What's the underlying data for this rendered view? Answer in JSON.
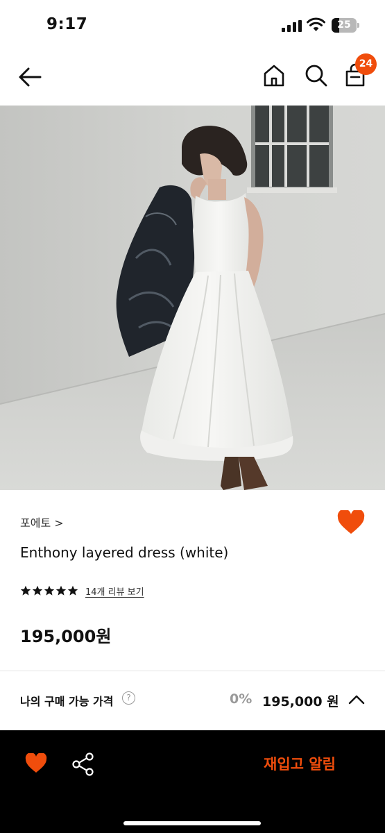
{
  "status": {
    "time": "9:17",
    "battery": "25"
  },
  "nav": {
    "cart_count": "24"
  },
  "product": {
    "brand": "포에토",
    "brand_chevron": ">",
    "name": "Enthony layered dress (white)",
    "review_link": "14개 리뷰 보기",
    "rating_stars": 5,
    "price": "195,000원"
  },
  "my_price": {
    "label": "나의 구매 가능 가격",
    "help": "?",
    "discount": "0%",
    "value": "195,000 원"
  },
  "bottom": {
    "restock_label": "재입고 알림"
  },
  "colors": {
    "accent": "#f04d0c",
    "bottom_bar": "#000000"
  },
  "icons": [
    "back-arrow-icon",
    "home-icon",
    "search-icon",
    "cart-bag-icon",
    "heart-icon",
    "star-icon",
    "help-icon",
    "chevron-up-icon",
    "share-icon"
  ]
}
